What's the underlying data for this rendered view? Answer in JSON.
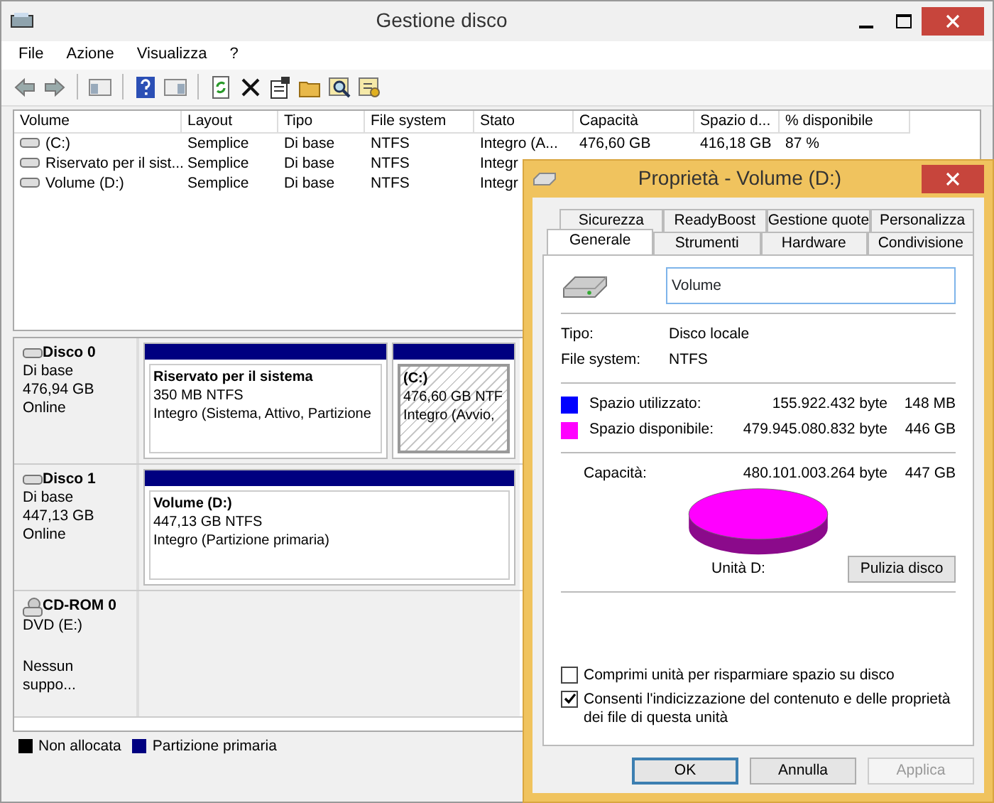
{
  "window": {
    "title": "Gestione disco"
  },
  "menu": [
    {
      "label": "File"
    },
    {
      "label": "Azione"
    },
    {
      "label": "Visualizza"
    },
    {
      "label": "?"
    }
  ],
  "volume_table": {
    "columns": [
      "Volume",
      "Layout",
      "Tipo",
      "File system",
      "Stato",
      "Capacità",
      "Spazio d...",
      "% disponibile"
    ],
    "rows": [
      {
        "cells": [
          "(C:)",
          "Semplice",
          "Di base",
          "NTFS",
          "Integro (A...",
          "476,60 GB",
          "416,18 GB",
          "87 %"
        ]
      },
      {
        "cells": [
          "Riservato per il sist...",
          "Semplice",
          "Di base",
          "NTFS",
          "Integr"
        ]
      },
      {
        "cells": [
          "Volume (D:)",
          "Semplice",
          "Di base",
          "NTFS",
          "Integr"
        ]
      }
    ]
  },
  "disks": [
    {
      "kind": "disk",
      "name": "Disco 0",
      "lines": [
        "Di base",
        "476,94 GB",
        "Online"
      ],
      "partitions": [
        {
          "title": "Riservato per il sistema",
          "lines": [
            "350 MB NTFS",
            "Integro (Sistema, Attivo, Partizione"
          ],
          "selected": false
        },
        {
          "title": "(C:)",
          "lines": [
            "476,60 GB NTF",
            "Integro (Avvio,"
          ],
          "selected": true
        }
      ]
    },
    {
      "kind": "disk",
      "name": "Disco 1",
      "lines": [
        "Di base",
        "447,13 GB",
        "Online"
      ],
      "partitions": [
        {
          "title": "Volume  (D:)",
          "lines": [
            "447,13 GB NTFS",
            "Integro (Partizione primaria)"
          ],
          "selected": false
        }
      ]
    },
    {
      "kind": "cdrom",
      "name": "CD-ROM 0",
      "lines": [
        "DVD (E:)",
        "Nessun suppo..."
      ]
    }
  ],
  "legend": [
    {
      "label": "Non allocata",
      "color": "#000000"
    },
    {
      "label": "Partizione primaria",
      "color": "#000080"
    }
  ],
  "dialog": {
    "title": "Proprietà - Volume (D:)",
    "tab_rows": [
      [
        {
          "label": "Sicurezza",
          "selected": false
        },
        {
          "label": "ReadyBoost",
          "selected": false
        },
        {
          "label": "Gestione quote",
          "selected": false
        },
        {
          "label": "Personalizza",
          "selected": false
        }
      ],
      [
        {
          "label": "Generale",
          "selected": true
        },
        {
          "label": "Strumenti",
          "selected": false
        },
        {
          "label": "Hardware",
          "selected": false
        },
        {
          "label": "Condivisione",
          "selected": false
        }
      ]
    ],
    "name_field": {
      "value": "Volume"
    },
    "info": [
      {
        "label": "Tipo:",
        "value": "Disco locale"
      },
      {
        "label": "File system:",
        "value": "NTFS"
      }
    ],
    "space": [
      {
        "label": "Spazio utilizzato:",
        "bytes": "155.922.432 byte",
        "size": "148 MB",
        "color": "#0000ff"
      },
      {
        "label": "Spazio disponibile:",
        "bytes": "479.945.080.832 byte",
        "size": "446 GB",
        "color": "#ff00ff"
      }
    ],
    "capacity": {
      "label": "Capacità:",
      "bytes": "480.101.003.264 byte",
      "size": "447 GB"
    },
    "drive_label": "Unità D:",
    "cleanup_button": "Pulizia disco",
    "options": [
      {
        "label": "Comprimi unità per risparmiare spazio su disco",
        "checked": false
      },
      {
        "label": "Consenti l'indicizzazione del contenuto e delle proprietà dei file di questa unità",
        "checked": true
      }
    ],
    "buttons": [
      {
        "label": "OK",
        "default": true,
        "disabled": false
      },
      {
        "label": "Annulla",
        "default": false,
        "disabled": false
      },
      {
        "label": "Applica",
        "default": false,
        "disabled": true
      }
    ]
  }
}
